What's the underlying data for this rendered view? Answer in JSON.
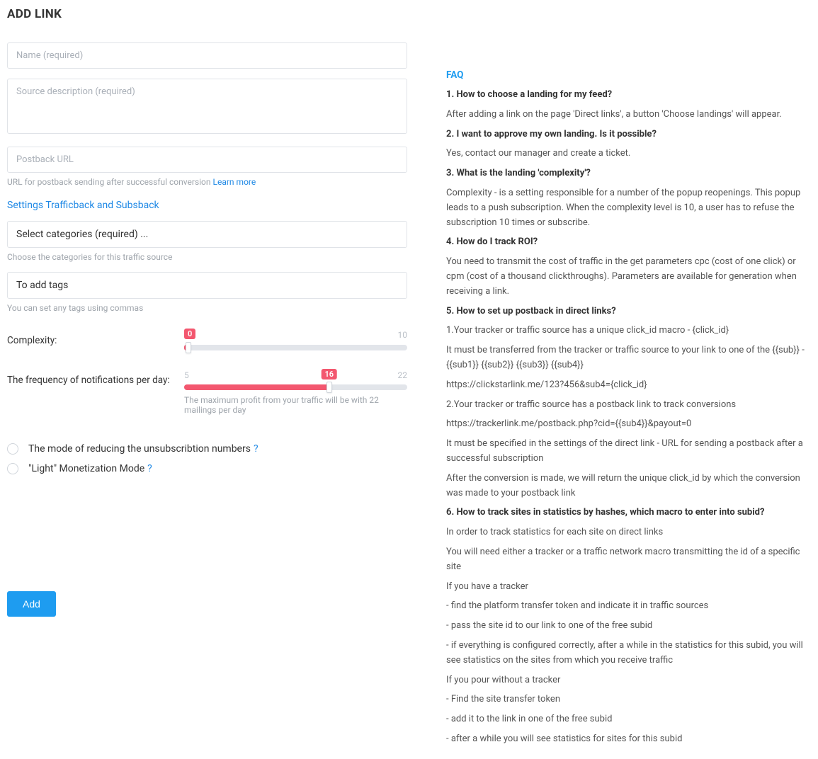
{
  "heading": "ADD LINK",
  "fields": {
    "namePlaceholder": "Name (required)",
    "descPlaceholder": "Source description (required)",
    "postbackPlaceholder": "Postback URL",
    "postbackHint": "URL for postback sending after successful conversion ",
    "postbackLearn": "Learn more",
    "trafficbackLink": "Settings Trafficback and Subsback",
    "categoriesPlaceholder": "Select categories (required) ...",
    "categoriesHint": "Choose the categories for this traffic source",
    "tagsPlaceholder": "To add tags",
    "tagsHint": "You can set any tags using commas"
  },
  "sliders": {
    "complexity": {
      "label": "Complexity:",
      "min": "0",
      "max": "10",
      "value": "0"
    },
    "frequency": {
      "label": "The frequency of notifications per day:",
      "min": "5",
      "max": "22",
      "value": "16",
      "note": "The maximum profit from your traffic will be with 22 mailings per day"
    }
  },
  "checkboxes": {
    "reduce": "The mode of reducing the unsubscribtion numbers",
    "light": "\"Light\" Monetization Mode",
    "q": "?"
  },
  "addBtn": "Add",
  "faq": {
    "title": "FAQ",
    "q1": "1. How to choose a landing for my feed?",
    "a1": "After adding a link on the page 'Direct links', a button 'Choose landings' will appear.",
    "q2": "2. I want to approve my own landing. Is it possible?",
    "a2": "Yes, contact our manager and create a ticket.",
    "q3": "3. What is the landing 'complexity'?",
    "a3": "Complexity - is a setting responsible for a number of the popup reopenings. This popup leads to a push subscription. When the complexity level is 10, a user has to refuse the subscription 10 times or subscribe.",
    "q4": "4. How do I track ROI?",
    "a4": "You need to transmit the cost of traffic in the get parameters cpc (cost of one click) or cpm (cost of a thousand clickthroughs). Parameters are available for generation when receiving a link.",
    "q5": "5. How to set up postback in direct links?",
    "a5a": "1.Your tracker or traffic source has a unique click_id macro - {click_id}",
    "a5b": "It must be transferred from the tracker or traffic source to your link to one of the {{sub}} - {{sub1}} {{sub2}} {{sub3}} {{sub4}}",
    "a5c": "https://clickstarlink.me/123?456&sub4={click_id}",
    "a5d": "2.Your tracker or traffic source has a postback link to track conversions",
    "a5e": "https://trackerlink.me/postback.php?cid={{sub4}}&payout=0",
    "a5f": "It must be specified in the settings of the direct link - URL for sending a postback after a successful subscription",
    "a5g": "After the conversion is made, we will return the unique click_id by which the conversion was made to your postback link",
    "q6": "6. How to track sites in statistics by hashes, which macro to enter into subid?",
    "a6a": "In order to track statistics for each site on direct links",
    "a6b": "You will need either a tracker or a traffic network macro transmitting the id of a specific site",
    "a6c": "If you have a tracker",
    "a6d": "- find the platform transfer token and indicate it in traffic sources",
    "a6e": "- pass the site id to our link to one of the free subid",
    "a6f": "- if everything is configured correctly, after a while in the statistics for this subid, you will see statistics on the sites from which you receive traffic",
    "a6g": "If you pour without a tracker",
    "a6h": "- Find the site transfer token",
    "a6i": "- add it to the link in one of the free subid",
    "a6j": "- after a while you will see statistics for sites for this subid"
  }
}
